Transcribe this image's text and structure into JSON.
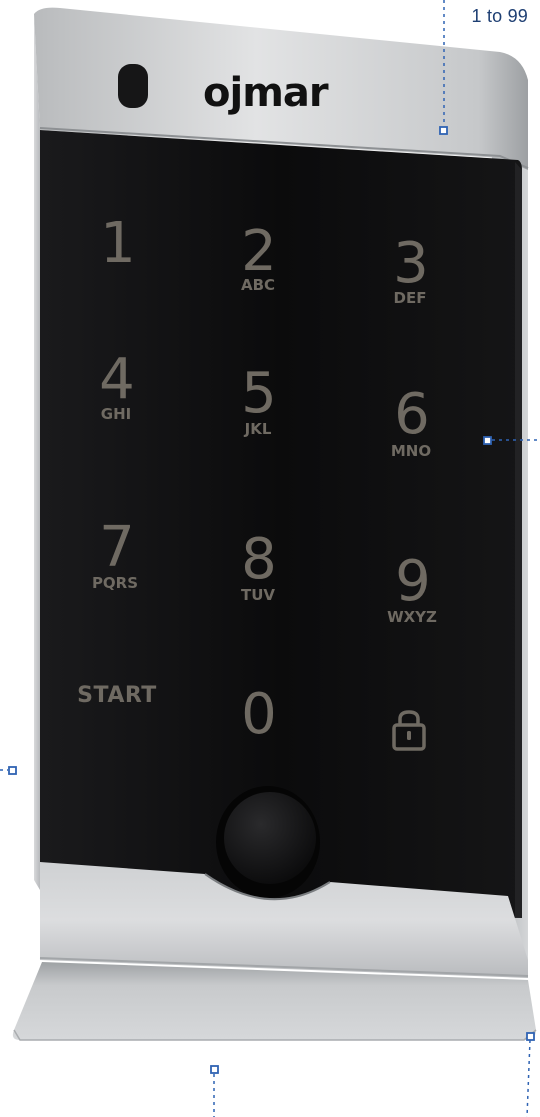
{
  "brand": {
    "logo_text": "ojmar"
  },
  "callout": {
    "range_label": "1 to 99"
  },
  "keypad": {
    "keys": [
      {
        "digit": "1",
        "letters": ""
      },
      {
        "digit": "2",
        "letters": "ABC"
      },
      {
        "digit": "3",
        "letters": "DEF"
      },
      {
        "digit": "4",
        "letters": "GHI"
      },
      {
        "digit": "5",
        "letters": "JKL"
      },
      {
        "digit": "6",
        "letters": "MNO"
      },
      {
        "digit": "7",
        "letters": "PQRS"
      },
      {
        "digit": "8",
        "letters": "TUV"
      },
      {
        "digit": "9",
        "letters": "WXYZ"
      }
    ],
    "start_label": "START",
    "zero_label": "0",
    "lock_icon": "padlock-icon"
  },
  "colors": {
    "housing": "#c9cbcd",
    "panel": "#0d0d0e",
    "key_text": "#6f6a62",
    "callout": "#2f63b3"
  }
}
